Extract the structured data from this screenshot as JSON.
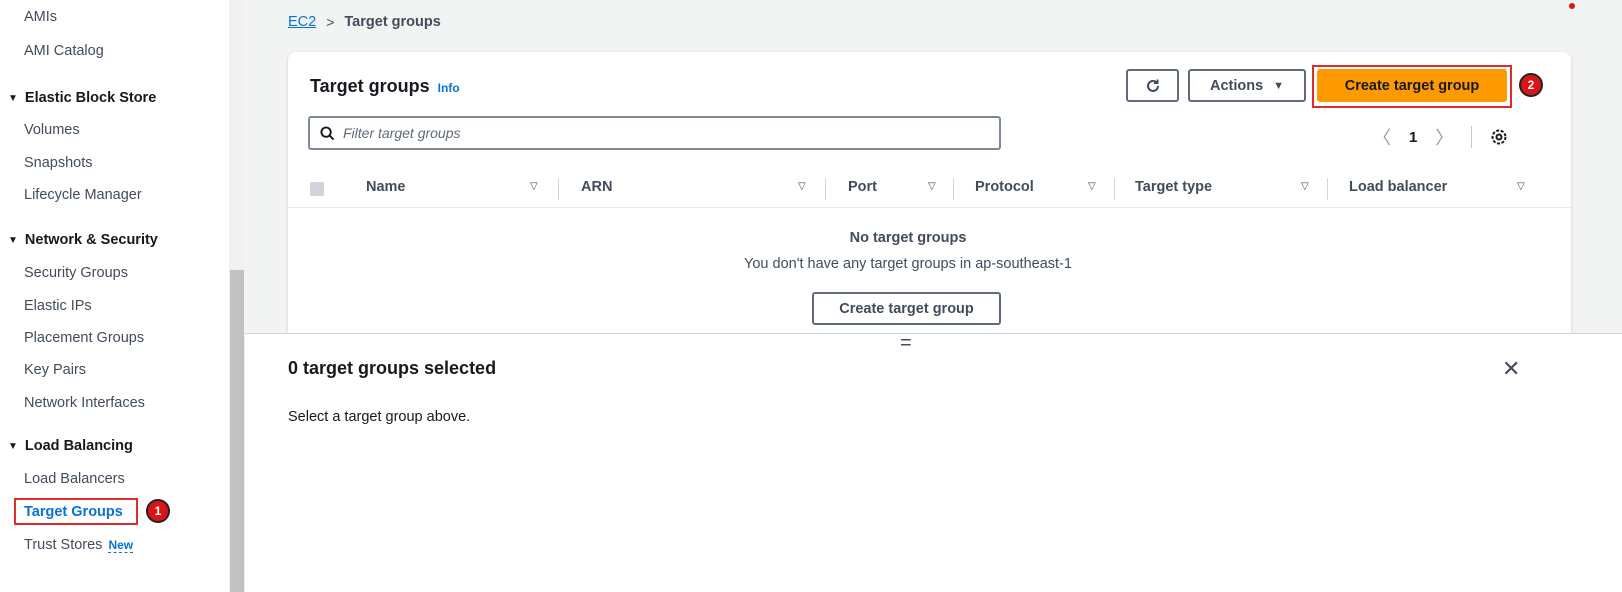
{
  "sidebar": {
    "items_top": [
      {
        "label": "AMIs"
      },
      {
        "label": "AMI Catalog"
      }
    ],
    "sections": [
      {
        "title": "Elastic Block Store",
        "items": [
          {
            "label": "Volumes"
          },
          {
            "label": "Snapshots"
          },
          {
            "label": "Lifecycle Manager"
          }
        ]
      },
      {
        "title": "Network & Security",
        "items": [
          {
            "label": "Security Groups"
          },
          {
            "label": "Elastic IPs"
          },
          {
            "label": "Placement Groups"
          },
          {
            "label": "Key Pairs"
          },
          {
            "label": "Network Interfaces"
          }
        ]
      },
      {
        "title": "Load Balancing",
        "items": [
          {
            "label": "Load Balancers"
          },
          {
            "label": "Target Groups",
            "active": true
          },
          {
            "label": "Trust Stores",
            "tag": "New"
          }
        ]
      }
    ],
    "step_badge": "1"
  },
  "breadcrumb": {
    "root": "EC2",
    "separator": ">",
    "current": "Target groups"
  },
  "panel": {
    "title": "Target groups",
    "info": "Info",
    "actions_label": "Actions",
    "create_label": "Create target group",
    "step_badge": "2",
    "filter_placeholder": "Filter target groups",
    "page_number": "1",
    "columns": [
      "Name",
      "ARN",
      "Port",
      "Protocol",
      "Target type",
      "Load balancer"
    ],
    "empty_title": "No target groups",
    "empty_sub": "You don't have any target groups in ap-southeast-1",
    "empty_button": "Create target group"
  },
  "split": {
    "title": "0 target groups selected",
    "subtitle": "Select a target group above."
  },
  "icons": {
    "refresh": "refresh-icon",
    "caret": "caret-down-icon",
    "search": "search-icon",
    "settings": "gear-icon",
    "close": "close-icon"
  },
  "colors": {
    "accent": "#0972d3",
    "primary_button": "#ff9900",
    "highlight": "#e02b2b"
  }
}
